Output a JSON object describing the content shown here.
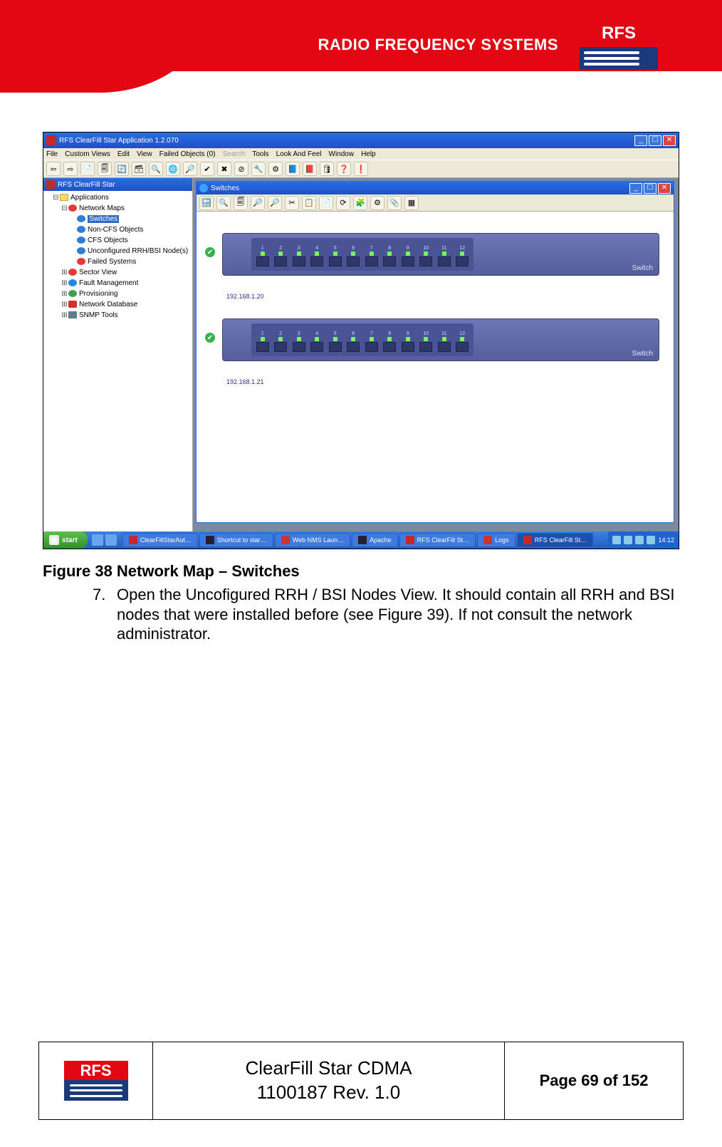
{
  "header": {
    "brand_text": "RADIO FREQUENCY SYSTEMS",
    "logo_abbr": "RFS"
  },
  "screenshot": {
    "app_title": "RFS ClearFill Star Application 1.2.070",
    "menus": [
      "File",
      "Custom Views",
      "Edit",
      "View",
      "Failed Objects (0)",
      "Search",
      "Tools",
      "Look And Feel",
      "Window",
      "Help"
    ],
    "menu_disabled_index": 5,
    "toolbar_icons": [
      "⇦",
      "⇨",
      "📄",
      "🗐",
      "🔄",
      "🗃",
      "🔍",
      "🌐",
      "🔎",
      "✔",
      "✖",
      "⊘",
      "🔧",
      "⚙",
      "📘",
      "📕",
      "🛢",
      "❓",
      "❗"
    ],
    "tree_title": "RFS ClearFill Star",
    "tree": [
      {
        "indent": 1,
        "tw": "⊟",
        "icon": "ic-folder",
        "label": "Applications"
      },
      {
        "indent": 2,
        "tw": "⊟",
        "icon": "ic-red",
        "label": "Network Maps"
      },
      {
        "indent": 3,
        "tw": "",
        "icon": "ic-globe",
        "label": "Switches",
        "selected": true
      },
      {
        "indent": 3,
        "tw": "",
        "icon": "ic-globe",
        "label": "Non-CFS Objects"
      },
      {
        "indent": 3,
        "tw": "",
        "icon": "ic-globe",
        "label": "CFS Objects"
      },
      {
        "indent": 3,
        "tw": "",
        "icon": "ic-globe",
        "label": "Unconfigured RRH/BSI Node(s)"
      },
      {
        "indent": 3,
        "tw": "",
        "icon": "ic-red",
        "label": "Failed Systems"
      },
      {
        "indent": 2,
        "tw": "⊞",
        "icon": "ic-red",
        "label": "Sector View"
      },
      {
        "indent": 2,
        "tw": "⊞",
        "icon": "ic-blue",
        "label": "Fault Management"
      },
      {
        "indent": 2,
        "tw": "⊞",
        "icon": "ic-green",
        "label": "Provisioning"
      },
      {
        "indent": 2,
        "tw": "⊞",
        "icon": "ic-db",
        "label": "Network Database"
      },
      {
        "indent": 2,
        "tw": "⊞",
        "icon": "ic-tool",
        "label": "SNMP Tools"
      }
    ],
    "child_title": "Switches",
    "child_toolbar_icons": [
      "🔙",
      "🔍",
      "🗐",
      "🔎",
      "🔎",
      "✂",
      "📋",
      "📄",
      "⟳",
      "🧩",
      "⚙",
      "📎",
      "▦"
    ],
    "switches": [
      {
        "ip": "192.168.1.20",
        "label": "Switch",
        "port_count": 12
      },
      {
        "ip": "192.168.1.21",
        "label": "Switch",
        "port_count": 12
      }
    ],
    "taskbar": {
      "start_label": "start",
      "items": [
        {
          "label": "ClearFillStarAut…",
          "icon": "#c62828"
        },
        {
          "label": "Shortcut to star…",
          "icon": "#223"
        },
        {
          "label": "Web NMS Laun…",
          "icon": "#c33"
        },
        {
          "label": "Apache",
          "icon": "#223"
        },
        {
          "label": "RFS ClearFill St…",
          "icon": "#c62828"
        },
        {
          "label": "Logs",
          "icon": "#c33"
        },
        {
          "label": "RFS ClearFill St…",
          "icon": "#c62828",
          "active": true
        }
      ],
      "clock": "14:12"
    }
  },
  "caption": "Figure 38 Network Map – Switches",
  "list": {
    "number": "7.",
    "text_l1": "Open the Uncofigured RRH / BSI Nodes View. It should contain all RRH and BSI",
    "text_l2": "nodes that were installed before (see Figure 39). If not consult the network",
    "text_l3": "administrator."
  },
  "footer": {
    "logo_abbr": "RFS",
    "mid_line1": "ClearFill Star CDMA",
    "mid_line2": "1100187 Rev. 1.0",
    "page": "Page 69 of 152"
  }
}
